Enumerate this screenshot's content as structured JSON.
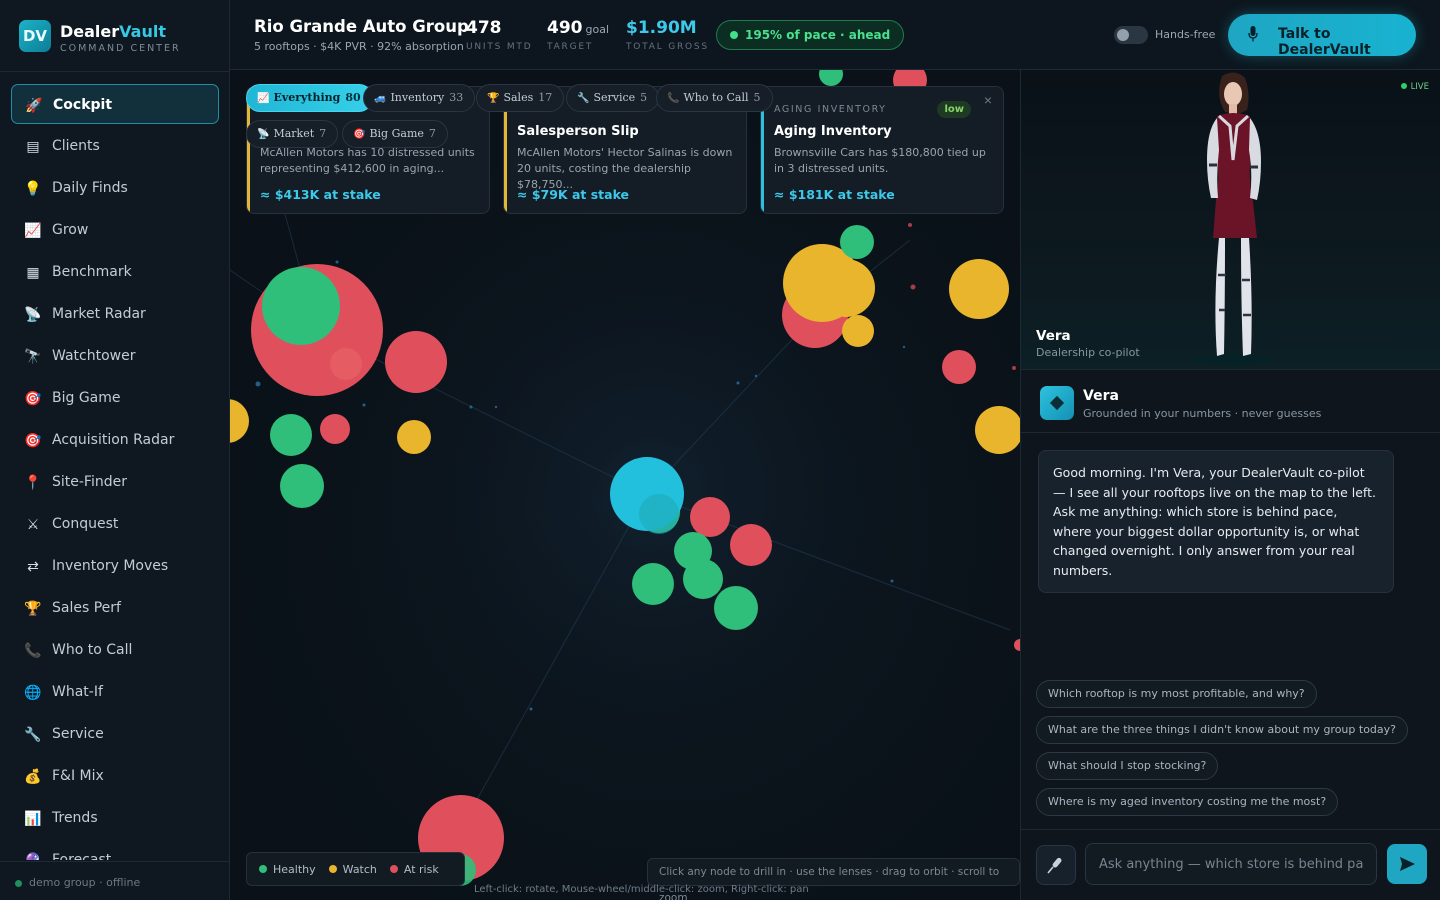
{
  "brand": {
    "logo": "DV",
    "name_a": "Dealer",
    "name_b": "Vault",
    "subtitle": "COMMAND CENTER"
  },
  "nav": [
    {
      "label": "Cockpit",
      "icon": "rocket-icon",
      "glyph": "🚀",
      "active": true
    },
    {
      "label": "Clients",
      "icon": "clients-icon",
      "glyph": "▤"
    },
    {
      "label": "Daily Finds",
      "icon": "lightbulb-icon",
      "glyph": "💡"
    },
    {
      "label": "Grow",
      "icon": "chart-up-icon",
      "glyph": "📈"
    },
    {
      "label": "Benchmark",
      "icon": "checkered-flag-icon",
      "glyph": "▦"
    },
    {
      "label": "Market Radar",
      "icon": "satellite-icon",
      "glyph": "📡"
    },
    {
      "label": "Watchtower",
      "icon": "telescope-icon",
      "glyph": "🔭"
    },
    {
      "label": "Big Game",
      "icon": "target-icon",
      "glyph": "🎯"
    },
    {
      "label": "Acquisition Radar",
      "icon": "target-icon",
      "glyph": "🎯"
    },
    {
      "label": "Site-Finder",
      "icon": "pin-icon",
      "glyph": "📍"
    },
    {
      "label": "Conquest",
      "icon": "swords-icon",
      "glyph": "⚔"
    },
    {
      "label": "Inventory Moves",
      "icon": "shuffle-icon",
      "glyph": "⇄"
    },
    {
      "label": "Sales Perf",
      "icon": "trophy-icon",
      "glyph": "🏆"
    },
    {
      "label": "Who to Call",
      "icon": "phone-icon",
      "glyph": "📞"
    },
    {
      "label": "What-If",
      "icon": "globe-icon",
      "glyph": "🌐"
    },
    {
      "label": "Service",
      "icon": "wrench-icon",
      "glyph": "🔧"
    },
    {
      "label": "F&I Mix",
      "icon": "money-bag-icon",
      "glyph": "💰"
    },
    {
      "label": "Trends",
      "icon": "bar-chart-icon",
      "glyph": "📊"
    },
    {
      "label": "Forecast",
      "icon": "crystal-ball-icon",
      "glyph": "🔮"
    }
  ],
  "sidebar_footer": "demo group · offline",
  "header": {
    "group_name": "Rio Grande Auto Group",
    "group_sub": "5 rooftops · $4K PVR · 92% absorption",
    "kpis": [
      {
        "value": "478",
        "suffix": "",
        "label": "UNITS MTD"
      },
      {
        "value": "490",
        "suffix": "goal",
        "label": "TARGET"
      },
      {
        "value": "$1.90M",
        "suffix": "",
        "label": "TOTAL GROSS"
      }
    ],
    "pace": "195% of pace · ahead",
    "handsfree_label": "Hands-free",
    "handsfree_on": false,
    "talk_label": "Talk to DealerVault"
  },
  "lenses": [
    {
      "label": "Everything",
      "count": "80",
      "icon": "chart-icon",
      "glyph": "📈",
      "active": true
    },
    {
      "label": "Inventory",
      "count": "33",
      "icon": "car-icon",
      "glyph": "🚙"
    },
    {
      "label": "Sales",
      "count": "17",
      "icon": "trophy-icon",
      "glyph": "🏆"
    },
    {
      "label": "Service",
      "count": "5",
      "icon": "wrench-icon",
      "glyph": "🔧"
    },
    {
      "label": "Who to Call",
      "count": "5",
      "icon": "phone-icon",
      "glyph": "📞"
    },
    {
      "label": "Market",
      "count": "7",
      "icon": "satellite-icon",
      "glyph": "📡"
    },
    {
      "label": "Big Game",
      "count": "7",
      "icon": "target-icon",
      "glyph": "🎯"
    }
  ],
  "cards": [
    {
      "kicker": "",
      "title": "",
      "desc": "McAllen Motors has 10 distressed units representing $412,600 in aging...",
      "stake": "≈ $413K at stake",
      "color": "#e2b636"
    },
    {
      "kicker": "",
      "title": "Salesperson Slip",
      "desc": "McAllen Motors' Hector Salinas is down 20 units, costing the dealership $78,750...",
      "stake": "≈ $79K at stake",
      "color": "#e2b636"
    },
    {
      "kicker": "AGING INVENTORY",
      "title": "Aging Inventory",
      "desc": "Brownsville Cars has $180,800 tied up in 3 distressed units.",
      "stake": "≈ $181K at stake",
      "color": "#2fbedc",
      "badge": "low"
    }
  ],
  "legend": [
    {
      "label": "Healthy",
      "color": "#2fbf7a"
    },
    {
      "label": "Watch",
      "color": "#e8b52c"
    },
    {
      "label": "At risk",
      "color": "#e0505c"
    }
  ],
  "hint": "Click any node to drill in · use the lenses · drag to orbit · scroll to zoom",
  "orbit_hint": "Left-click: rotate, Mouse-wheel/middle-click: zoom, Right-click: pan",
  "colors": {
    "accent": "#1fb7d5",
    "healthy": "#2fbf7a",
    "watch": "#e8b52c",
    "risk": "#e0505c"
  },
  "assistant": {
    "live": "LIVE",
    "name": "Vera",
    "role": "Dealership co-pilot",
    "tagline": "Grounded in your numbers · never guesses",
    "greeting": "Good morning. I'm Vera, your DealerVault co-pilot — I see all your rooftops live on the map to the left. Ask me anything: which store is behind pace, where your biggest dollar opportunity is, or what changed overnight. I only answer from your real numbers.",
    "suggestions": [
      "Which rooftop is my most profitable, and why?",
      "What are the three things I didn't know about my group today?",
      "What should I stop stocking?",
      "Where is my aged inventory costing me the most?"
    ],
    "input_placeholder": "Ask anything — which store is behind pace?"
  }
}
